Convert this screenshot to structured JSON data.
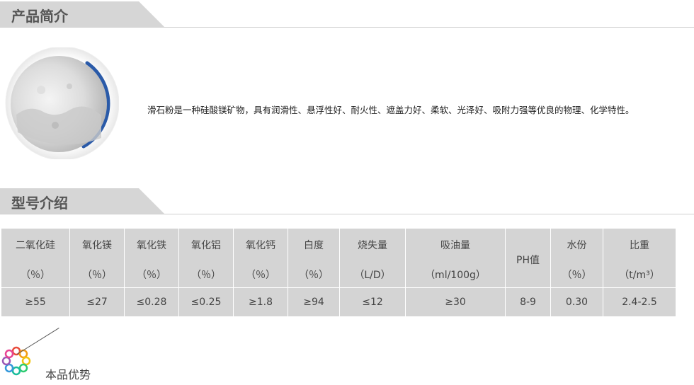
{
  "intro": {
    "section_title": "产品简介",
    "description": "滑石粉是一种硅酸镁矿物，具有润滑性、悬浮性好、耐火性、遮盖力好、柔软、光泽好、吸附力强等优良的物理、化学特性。"
  },
  "models": {
    "section_title": "型号介绍",
    "columns": [
      {
        "name": "二氧化硅",
        "unit": "（％）",
        "value": "≥55",
        "width": 96
      },
      {
        "name": "氧化镁",
        "unit": "（％）",
        "value": "≤27",
        "width": 76
      },
      {
        "name": "氧化铁",
        "unit": "（％）",
        "value": "≤0.28",
        "width": 76
      },
      {
        "name": "氧化铝",
        "unit": "（％）",
        "value": "≤0.25",
        "width": 76
      },
      {
        "name": "氧化钙",
        "unit": "（％）",
        "value": "≥1.8",
        "width": 76
      },
      {
        "name": "白度",
        "unit": "（％）",
        "value": "≥94",
        "width": 72
      },
      {
        "name": "烧失量",
        "unit": "（L/D）",
        "value": "≤12",
        "width": 92
      },
      {
        "name": "吸油量",
        "unit": "（ml/100g）",
        "value": "≥30",
        "width": 140
      },
      {
        "name": "PH值",
        "unit": "",
        "value": "8-9",
        "width": 63
      },
      {
        "name": "水份",
        "unit": "（％）",
        "value": "0.30",
        "width": 73
      },
      {
        "name": "比重",
        "unit": "（t/m³）",
        "value": "2.4-2.5",
        "width": 102
      }
    ]
  },
  "advantages": {
    "section_title": "本品优势"
  },
  "colors": {
    "header_tab": "#d6d6d6",
    "table_cell": "#d4d4d4",
    "ring_blue": "#2a5aa8"
  }
}
